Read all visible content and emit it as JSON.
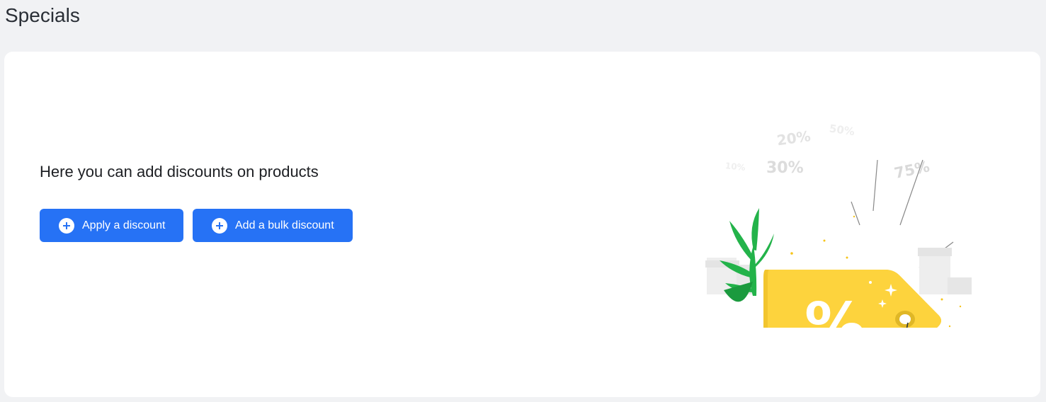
{
  "page": {
    "title": "Specials"
  },
  "content": {
    "headline": "Here you can add discounts on products",
    "buttons": {
      "apply_label": "Apply a discount",
      "bulk_label": "Add a bulk discount"
    }
  },
  "illustration": {
    "percent_labels": [
      "20%",
      "50%",
      "30%",
      "10%",
      "75%"
    ],
    "tag_symbol": "%",
    "icon": "discount-tag-illustration"
  },
  "colors": {
    "accent": "#2672f5",
    "tag": "#fdd33d",
    "leaf": "#23b34a",
    "background": "#f1f2f4"
  }
}
